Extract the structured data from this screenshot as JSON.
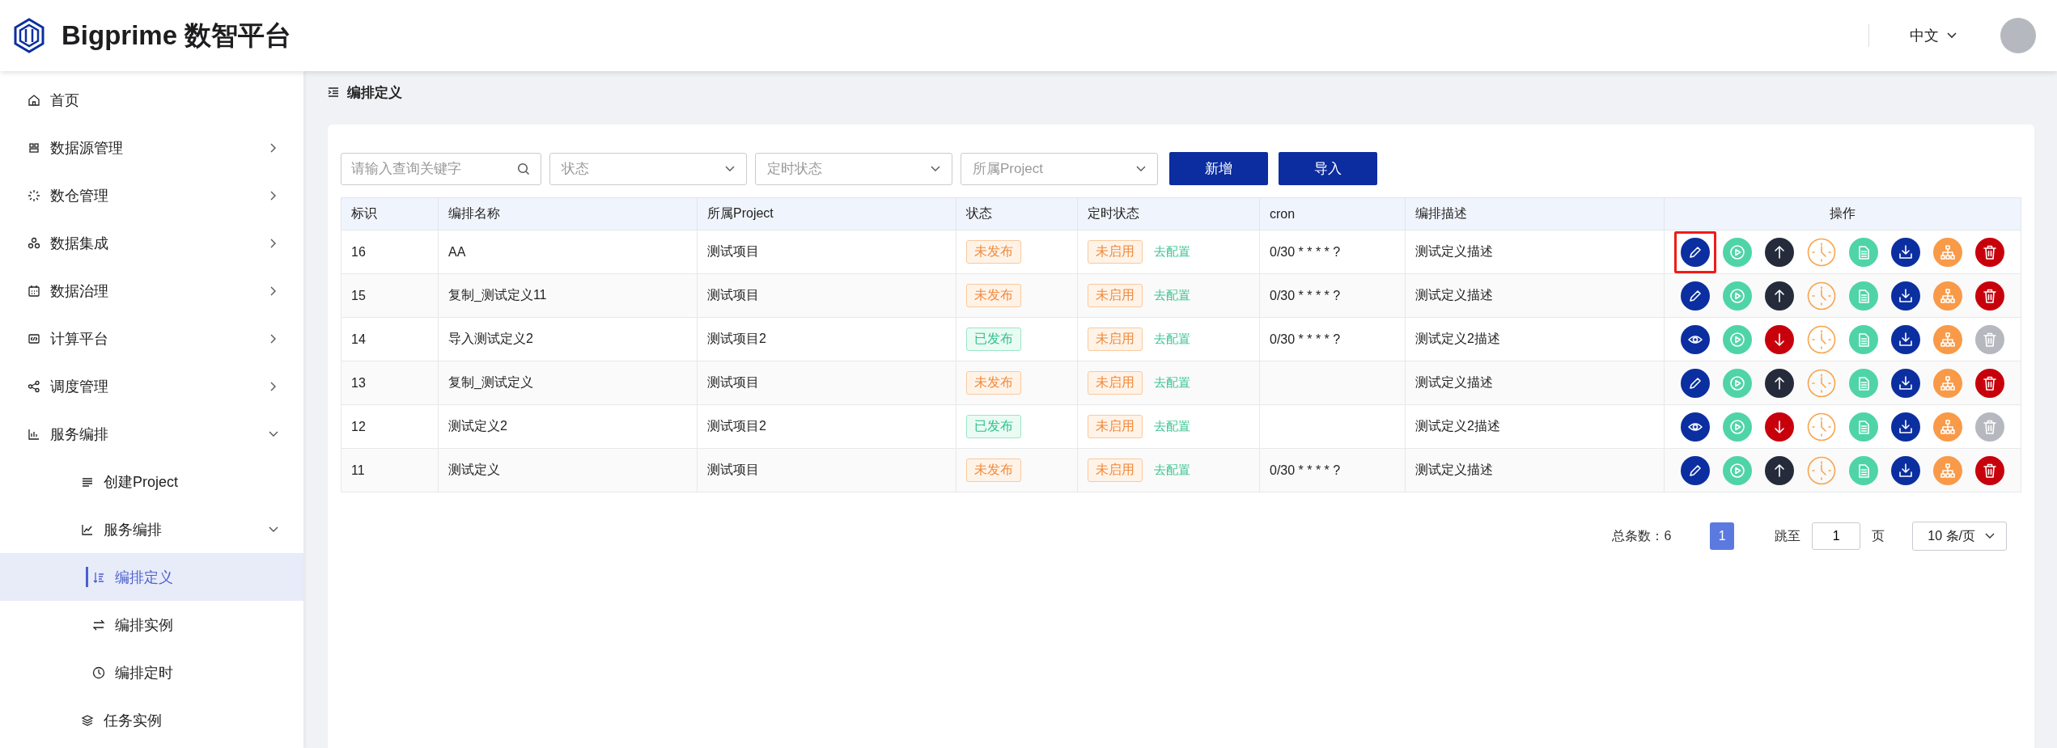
{
  "header": {
    "brand": "Bigprime 数智平台",
    "language": "中文"
  },
  "sidebar": {
    "items": [
      {
        "label": "首页",
        "kind": "home",
        "selected": false
      },
      {
        "label": "数据源管理",
        "kind": "database",
        "expanded": false,
        "selected": false
      },
      {
        "label": "数仓管理",
        "kind": "spark",
        "expanded": false,
        "selected": false
      },
      {
        "label": "数据集成",
        "kind": "triangle",
        "expanded": false,
        "selected": false
      },
      {
        "label": "数据治理",
        "kind": "calendar",
        "expanded": false,
        "selected": false
      },
      {
        "label": "计算平台",
        "kind": "code",
        "expanded": false,
        "selected": false
      },
      {
        "label": "调度管理",
        "kind": "share",
        "expanded": false,
        "selected": false
      },
      {
        "label": "服务编排",
        "kind": "bars",
        "expanded": true,
        "selected": false,
        "children": [
          {
            "label": "创建Project",
            "kind": "lines",
            "selected": false
          },
          {
            "label": "服务编排",
            "kind": "chart",
            "expanded": true,
            "selected": false,
            "children": [
              {
                "label": "编排定义",
                "kind": "sort",
                "selected": true
              },
              {
                "label": "编排实例",
                "kind": "swap",
                "selected": false
              },
              {
                "label": "编排定时",
                "kind": "clock",
                "selected": false
              }
            ]
          },
          {
            "label": "任务实例",
            "kind": "layers",
            "selected": false
          }
        ]
      }
    ]
  },
  "breadcrumb": "编排定义",
  "toolbar": {
    "search": {
      "placeholder": "请输入查询关键字"
    },
    "filters": [
      {
        "placeholder": "状态"
      },
      {
        "placeholder": "定时状态"
      },
      {
        "placeholder": "所属Project"
      }
    ],
    "buttons": [
      "新增",
      "导入"
    ]
  },
  "table": {
    "columns": [
      "标识",
      "编排名称",
      "所属Project",
      "状态",
      "定时状态",
      "cron",
      "编排描述",
      "操作"
    ],
    "rows": [
      {
        "id": "16",
        "name": "AA",
        "project": "测试项目",
        "status": {
          "text": "未发布",
          "published": false
        },
        "timer": {
          "text": "未启用",
          "link": "去配置"
        },
        "cron": "0/30 * * * * ?",
        "description": "测试定义描述",
        "actions": [
          {
            "kind": "edit",
            "highlighted": true,
            "disabled": false
          },
          {
            "kind": "run",
            "highlighted": false,
            "disabled": false
          },
          {
            "kind": "publish",
            "highlighted": false,
            "disabled": false
          },
          {
            "kind": "schedule",
            "highlighted": false,
            "disabled": false
          },
          {
            "kind": "copy",
            "highlighted": false,
            "disabled": false
          },
          {
            "kind": "export",
            "highlighted": false,
            "disabled": false
          },
          {
            "kind": "lineage",
            "highlighted": false,
            "disabled": false
          },
          {
            "kind": "delete",
            "highlighted": false,
            "disabled": false
          }
        ]
      },
      {
        "id": "15",
        "name": "复制_测试定义11",
        "project": "测试项目",
        "status": {
          "text": "未发布",
          "published": false
        },
        "timer": {
          "text": "未启用",
          "link": "去配置"
        },
        "cron": "0/30 * * * * ?",
        "description": "测试定义描述",
        "actions": [
          {
            "kind": "edit",
            "highlighted": false,
            "disabled": false
          },
          {
            "kind": "run",
            "highlighted": false,
            "disabled": false
          },
          {
            "kind": "publish",
            "highlighted": false,
            "disabled": false
          },
          {
            "kind": "schedule",
            "highlighted": false,
            "disabled": false
          },
          {
            "kind": "copy",
            "highlighted": false,
            "disabled": false
          },
          {
            "kind": "export",
            "highlighted": false,
            "disabled": false
          },
          {
            "kind": "lineage",
            "highlighted": false,
            "disabled": false
          },
          {
            "kind": "delete",
            "highlighted": false,
            "disabled": false
          }
        ]
      },
      {
        "id": "14",
        "name": "导入测试定义2",
        "project": "测试项目2",
        "status": {
          "text": "已发布",
          "published": true
        },
        "timer": {
          "text": "未启用",
          "link": "去配置"
        },
        "cron": "0/30 * * * * ?",
        "description": "测试定义2描述",
        "actions": [
          {
            "kind": "view",
            "highlighted": false,
            "disabled": false
          },
          {
            "kind": "run",
            "highlighted": false,
            "disabled": false
          },
          {
            "kind": "unpublish",
            "highlighted": false,
            "disabled": false
          },
          {
            "kind": "schedule",
            "highlighted": false,
            "disabled": false
          },
          {
            "kind": "copy",
            "highlighted": false,
            "disabled": false
          },
          {
            "kind": "export",
            "highlighted": false,
            "disabled": false
          },
          {
            "kind": "lineage",
            "highlighted": false,
            "disabled": false
          },
          {
            "kind": "delete",
            "highlighted": false,
            "disabled": true
          }
        ]
      },
      {
        "id": "13",
        "name": "复制_测试定义",
        "project": "测试项目",
        "status": {
          "text": "未发布",
          "published": false
        },
        "timer": {
          "text": "未启用",
          "link": "去配置"
        },
        "description": "测试定义描述",
        "actions": [
          {
            "kind": "edit",
            "highlighted": false,
            "disabled": false
          },
          {
            "kind": "run",
            "highlighted": false,
            "disabled": false
          },
          {
            "kind": "publish",
            "highlighted": false,
            "disabled": false
          },
          {
            "kind": "schedule",
            "highlighted": false,
            "disabled": false
          },
          {
            "kind": "copy",
            "highlighted": false,
            "disabled": false
          },
          {
            "kind": "export",
            "highlighted": false,
            "disabled": false
          },
          {
            "kind": "lineage",
            "highlighted": false,
            "disabled": false
          },
          {
            "kind": "delete",
            "highlighted": false,
            "disabled": false
          }
        ]
      },
      {
        "id": "12",
        "name": "测试定义2",
        "project": "测试项目2",
        "status": {
          "text": "已发布",
          "published": true
        },
        "timer": {
          "text": "未启用",
          "link": "去配置"
        },
        "description": "测试定义2描述",
        "actions": [
          {
            "kind": "view",
            "highlighted": false,
            "disabled": false
          },
          {
            "kind": "run",
            "highlighted": false,
            "disabled": false
          },
          {
            "kind": "unpublish",
            "highlighted": false,
            "disabled": false
          },
          {
            "kind": "schedule",
            "highlighted": false,
            "disabled": false
          },
          {
            "kind": "copy",
            "highlighted": false,
            "disabled": false
          },
          {
            "kind": "export",
            "highlighted": false,
            "disabled": false
          },
          {
            "kind": "lineage",
            "highlighted": false,
            "disabled": false
          },
          {
            "kind": "delete",
            "highlighted": false,
            "disabled": true
          }
        ]
      },
      {
        "id": "11",
        "name": "测试定义",
        "project": "测试项目",
        "status": {
          "text": "未发布",
          "published": false
        },
        "timer": {
          "text": "未启用",
          "link": "去配置"
        },
        "cron": "0/30 * * * * ?",
        "description": "测试定义描述",
        "actions": [
          {
            "kind": "edit",
            "highlighted": false,
            "disabled": false
          },
          {
            "kind": "run",
            "highlighted": false,
            "disabled": false
          },
          {
            "kind": "publish",
            "highlighted": false,
            "disabled": false
          },
          {
            "kind": "schedule",
            "highlighted": false,
            "disabled": false
          },
          {
            "kind": "copy",
            "highlighted": false,
            "disabled": false
          },
          {
            "kind": "export",
            "highlighted": false,
            "disabled": false
          },
          {
            "kind": "lineage",
            "highlighted": false,
            "disabled": false
          },
          {
            "kind": "delete",
            "highlighted": false,
            "disabled": false
          }
        ]
      }
    ]
  },
  "pagination": {
    "total": "总条数：6",
    "pages": [
      {
        "label": "1",
        "selected": true
      }
    ],
    "jump_label": "跳至",
    "jump_value": "1",
    "page_unit": "页",
    "page_size": "10 条/页"
  }
}
